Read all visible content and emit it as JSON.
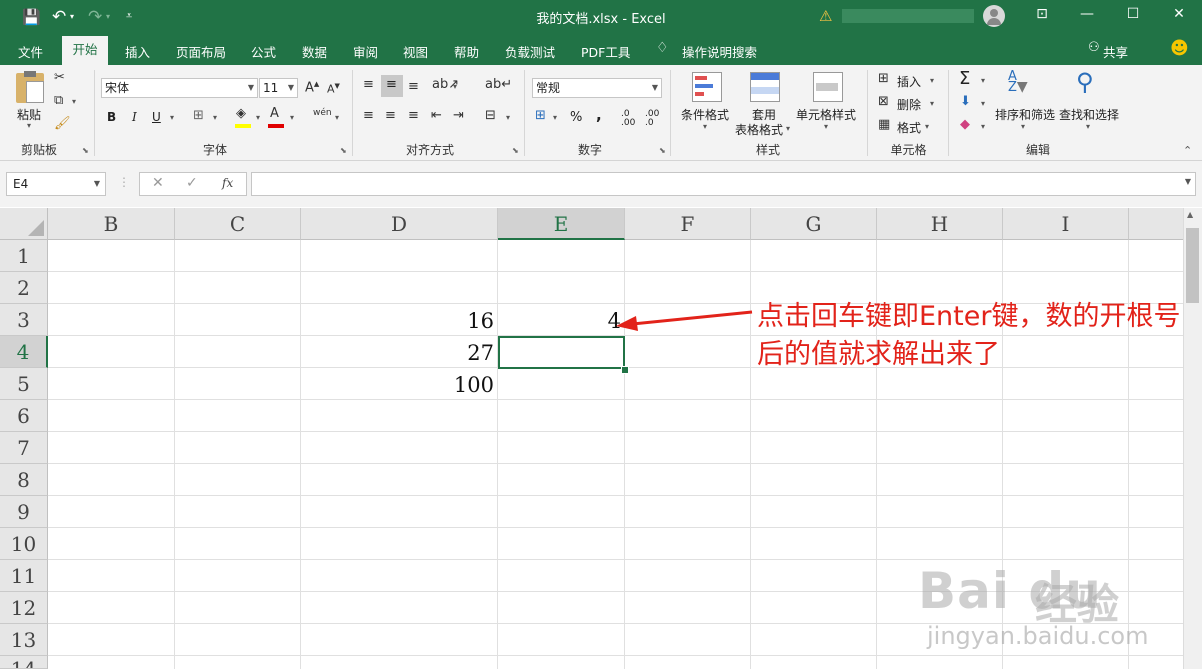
{
  "window": {
    "title": "我的文档.xlsx  -  Excel",
    "minimize_icon": "—",
    "maximize_icon": "☐",
    "close_icon": "✕"
  },
  "menu_tabs": [
    "文件",
    "开始",
    "插入",
    "页面布局",
    "公式",
    "数据",
    "审阅",
    "视图",
    "帮助",
    "负载测试",
    "PDF工具",
    "操作说明搜索"
  ],
  "share_label": "共享",
  "ribbon": {
    "clipboard": {
      "paste_label": "粘贴",
      "group_label": "剪贴板"
    },
    "font": {
      "font_name": "宋体",
      "font_size": "11",
      "group_label": "字体",
      "bold": "B",
      "italic": "I",
      "underline": "U",
      "wen": "wén"
    },
    "alignment": {
      "group_label": "对齐方式"
    },
    "number": {
      "format": "常规",
      "group_label": "数字",
      "percent": "%",
      "comma": ","
    },
    "styles": {
      "conditional": "条件格式",
      "table_line1": "套用",
      "table_line2": "表格格式",
      "cell_styles": "单元格样式",
      "group_label": "样式"
    },
    "cells": {
      "insert": "插入",
      "delete": "删除",
      "format": "格式",
      "group_label": "单元格"
    },
    "editing": {
      "sort_filter": "排序和筛选",
      "find_select": "查找和选择",
      "group_label": "编辑"
    }
  },
  "formula_bar": {
    "name_box": "E4",
    "fx": "fx",
    "formula": ""
  },
  "columns": [
    "B",
    "C",
    "D",
    "E",
    "F",
    "G",
    "H",
    "I"
  ],
  "rows": [
    "1",
    "2",
    "3",
    "4",
    "5",
    "6",
    "7",
    "8",
    "9",
    "10",
    "11",
    "12",
    "13",
    "14"
  ],
  "cells": {
    "D3": "16",
    "E3": "4",
    "D4": "27",
    "D5": "100"
  },
  "selected_cell": "E4",
  "annotation": "点击回车键即Enter键，数的开根号后的值就求解出来了",
  "watermark": {
    "logo": "Bai du",
    "brand": "经验",
    "url": "jingyan.baidu.com"
  },
  "colors": {
    "excel_green": "#217346",
    "annotation_red": "#e2231a"
  }
}
